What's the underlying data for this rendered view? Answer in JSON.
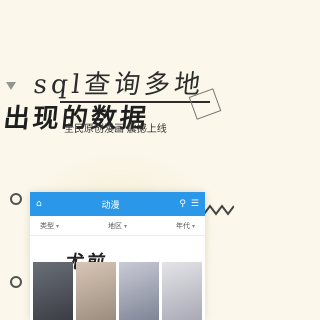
{
  "headline": {
    "line1": "sql查询多地",
    "line2": "出现的数据"
  },
  "tagline": "全民原创漫画 震撼上线",
  "app": {
    "title": "动漫",
    "icons": {
      "home": "home-icon",
      "search": "search-icon",
      "menu": "menu-icon"
    },
    "filters": [
      {
        "label": "类型"
      },
      {
        "label": "地区"
      },
      {
        "label": "年代"
      }
    ],
    "rank_text": "尤前"
  },
  "colors": {
    "accent": "#2b97e8",
    "background": "#fbf7ea"
  }
}
